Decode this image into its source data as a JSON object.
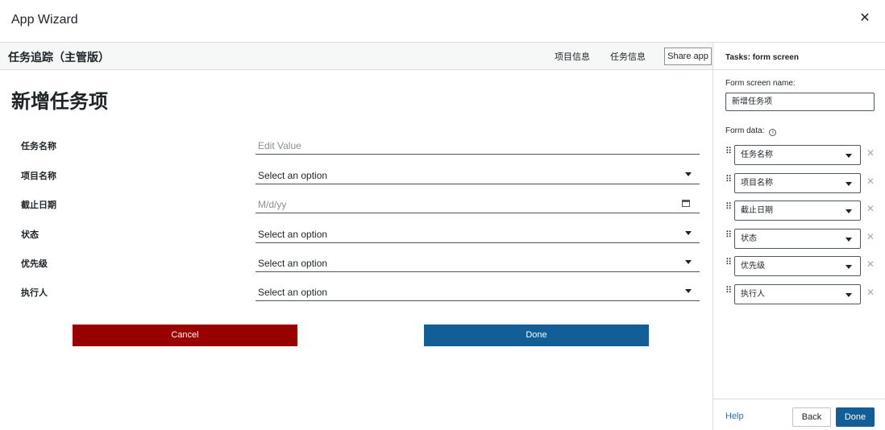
{
  "wizard": {
    "title": "App Wizard",
    "close_icon": "close-icon",
    "close_glyph": "✕"
  },
  "app": {
    "name": "任务追踪（主管版）",
    "nav": [
      {
        "label": "项目信息"
      },
      {
        "label": "任务信息"
      }
    ],
    "share_label": "Share app"
  },
  "screen": {
    "title": "新增任务项",
    "fields": [
      {
        "label": "任务名称",
        "value": "Edit Value",
        "control": "text",
        "placeholder": true
      },
      {
        "label": "项目名称",
        "value": "Select an option",
        "control": "select"
      },
      {
        "label": "截止日期",
        "value": "M/d/yy",
        "control": "date",
        "placeholder": true
      },
      {
        "label": "状态",
        "value": "Select an option",
        "control": "select"
      },
      {
        "label": "优先级",
        "value": "Select an option",
        "control": "select"
      },
      {
        "label": "执行人",
        "value": "Select an option",
        "control": "select"
      }
    ],
    "cancel_label": "Cancel",
    "done_label": "Done"
  },
  "panel": {
    "title": "Tasks: form screen",
    "screen_name_label": "Form screen name:",
    "screen_name_value": "新增任务项",
    "form_data_label": "Form data:",
    "form_data_items": [
      {
        "value": "任务名称"
      },
      {
        "value": "项目名称"
      },
      {
        "value": "截止日期"
      },
      {
        "value": "状态"
      },
      {
        "value": "优先级"
      },
      {
        "value": "执行人"
      }
    ],
    "help_label": "Help",
    "back_label": "Back",
    "done_label": "Done"
  },
  "colors": {
    "cancel": "#990000",
    "primary": "#135e96",
    "link": "#2271b1"
  }
}
